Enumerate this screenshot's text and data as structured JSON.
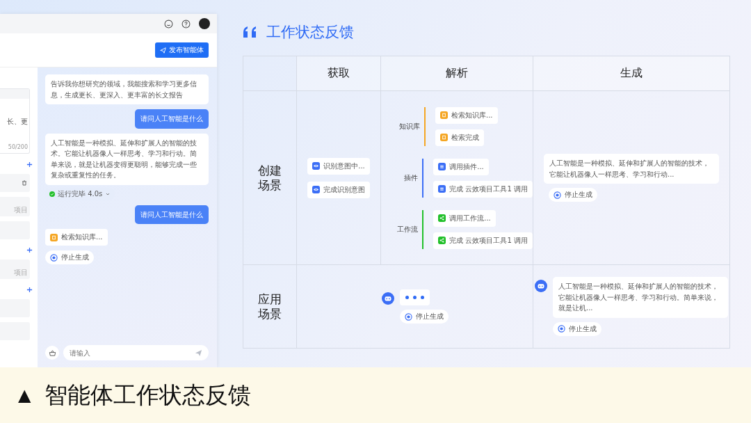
{
  "app": {
    "publish_button": "发布智能体",
    "sidebar": {
      "text_fragment": "长、更",
      "counter": "50/200",
      "labels": [
        "项目",
        "项目"
      ]
    },
    "chat": [
      {
        "kind": "bot",
        "text": "告诉我你想研究的领域，我能搜索和学习更多信息，生成更长、更深入、更丰富的长文报告"
      },
      {
        "kind": "user",
        "text": "请问人工智能是什么"
      },
      {
        "kind": "bot",
        "text": "人工智能是一种模拟、延伸和扩展人的智能的技术。它能让机器像人一样思考、学习和行动。简单来说，就是让机器变得更聪明，能够完成一些复杂或重复性的任务。"
      },
      {
        "kind": "status",
        "text": "运行完毕 4.0s"
      },
      {
        "kind": "user",
        "text": "请问人工智能是什么"
      },
      {
        "kind": "tool",
        "text": "检索知识库...",
        "color": "#f5a623"
      },
      {
        "kind": "stop",
        "text": "停止生成"
      }
    ],
    "input": {
      "placeholder": "请输入"
    }
  },
  "section_title": "工作状态反馈",
  "table": {
    "columns": [
      "获取",
      "解析",
      "生成"
    ],
    "create_row": {
      "label": "创建场景",
      "acquire": [
        "识别意图中...",
        "完成识别意图"
      ],
      "parse": [
        {
          "name": "知识库",
          "kind": "doc",
          "color": "#f5a623",
          "steps": [
            "检索知识库...",
            "检索完成"
          ]
        },
        {
          "name": "插件",
          "kind": "plugin",
          "color": "#3b6ef6",
          "steps": [
            "调用插件...",
            "完成 云效项目工具1 调用"
          ]
        },
        {
          "name": "工作流",
          "kind": "flow",
          "color": "#22c02a",
          "steps": [
            "调用工作流...",
            "完成 云效项目工具1 调用"
          ]
        }
      ],
      "generate": {
        "text": "人工智能是一种模拟、延伸和扩展人的智能的技术，它能让机器像人一样思考、学习和行动...",
        "stop": "停止生成"
      }
    },
    "apply_row": {
      "label": "应用场景",
      "waiting_stop": "停止生成",
      "generate": {
        "text": "人工智能是一种模拟、延伸和扩展人的智能的技术，它能让机器像人一样思考、学习和行动。简单来说，就是让机...",
        "stop": "停止生成"
      }
    }
  },
  "caption": {
    "mark": "▲",
    "text": "智能体工作状态反馈"
  }
}
